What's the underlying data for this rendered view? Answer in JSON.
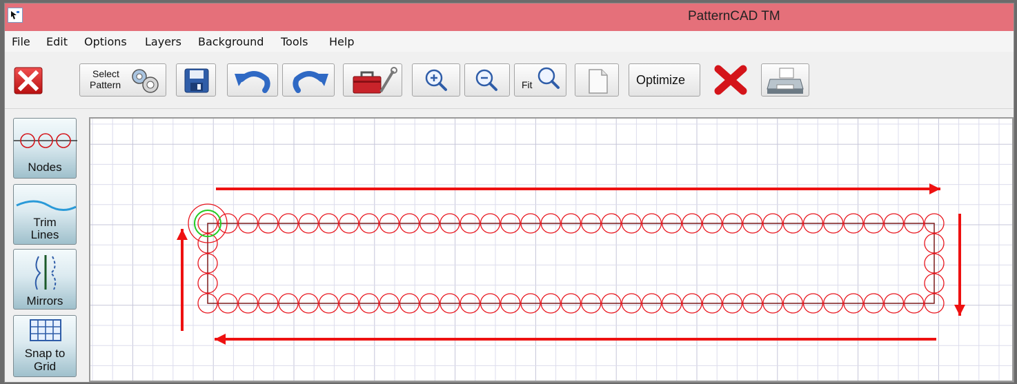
{
  "window": {
    "title": "PatternCAD TM"
  },
  "menu": {
    "items": [
      "File",
      "Edit",
      "Options",
      "Layers",
      "Background",
      "Tools",
      "Help"
    ]
  },
  "toolbar": {
    "exit_icon": "red-x-exit-icon",
    "select_pattern_label_line1": "Select",
    "select_pattern_label_line2": "Pattern",
    "save_icon": "floppy-disk-icon",
    "undo_icon": "undo-arrow-icon",
    "redo_icon": "redo-arrow-icon",
    "toolbox_icon": "toolbox-icon",
    "zoom_in_icon": "zoom-in-icon",
    "zoom_out_icon": "zoom-out-icon",
    "fit_label": "Fit",
    "page_icon": "blank-page-icon",
    "optimize_label": "Optimize",
    "delete_icon": "red-x-delete-icon",
    "print_icon": "printer-icon"
  },
  "sidebar": {
    "nodes_label": "Nodes",
    "trim_label_line1": "Trim",
    "trim_label_line2": "Lines",
    "mirrors_label": "Mirrors",
    "snap_label_line1": "Snap to",
    "snap_label_line2": "Grid"
  },
  "canvas": {
    "grid": true,
    "pattern": {
      "node_color": "#e8141c",
      "path_color": "#7a1a1a",
      "start_marker_color": "#22cc22",
      "arrow_color": "#ee1111",
      "top_row_nodes": 37,
      "right_column_inner_nodes": 3,
      "bottom_row_nodes": 37,
      "left_column_inner_nodes": 3,
      "direction": "clockwise"
    }
  },
  "colors": {
    "titlebar": "#e5707a",
    "accent_red": "#e8141c"
  }
}
